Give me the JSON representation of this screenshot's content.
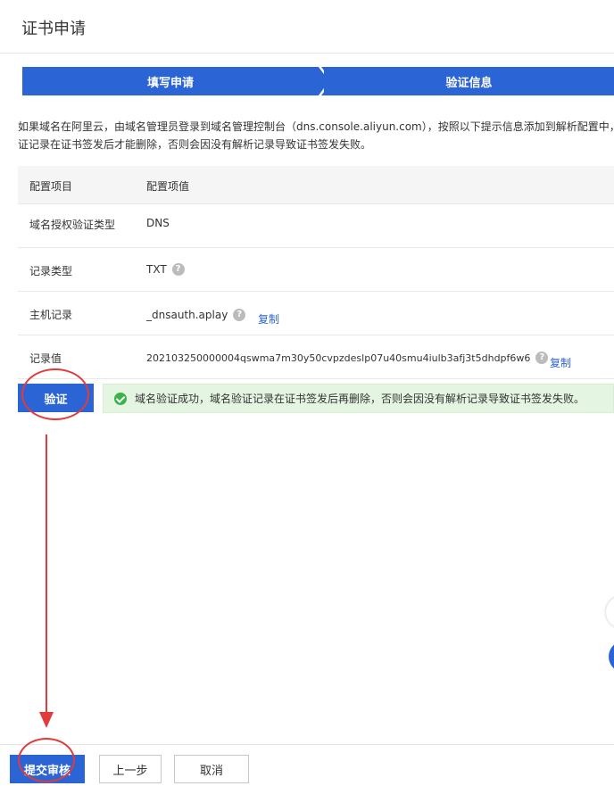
{
  "page": {
    "title": "证书申请"
  },
  "steps": [
    {
      "label": "填写申请"
    },
    {
      "label": "验证信息"
    }
  ],
  "notice": {
    "line1": "如果域名在阿里云，由域名管理员登录到域名管理控制台（dns.console.aliyun.com），按照以下提示信息添加到解析配置中，请",
    "line2": "证记录在证书签发后才能删除，否则会因没有解析记录导致证书签发失败。"
  },
  "table": {
    "header": {
      "key": "配置项目",
      "value": "配置项值"
    },
    "rows": [
      {
        "key": "域名授权验证类型",
        "value": "DNS"
      },
      {
        "key": "记录类型",
        "value": "TXT"
      },
      {
        "key": "主机记录",
        "value": "_dnsauth.aplay",
        "copy": "复制"
      },
      {
        "key": "记录值",
        "value": "202103250000004qswma7m30y50cvpzdeslp07u40smu4iulb3afj3t5dhdpf6w6",
        "copy": "复制"
      }
    ]
  },
  "verify": {
    "button": "验证",
    "success_message": "域名验证成功，域名验证记录在证书签发后再删除，否则会因没有解析记录导致证书签发失败。"
  },
  "footer": {
    "submit": "提交审核",
    "prev": "上一步",
    "cancel": "取消"
  },
  "colors": {
    "primary": "#2b64d5",
    "success": "#3bb34a",
    "annotation": "#e23b3b"
  },
  "icons": {
    "help": "question-circle-icon",
    "success": "check-circle-icon"
  }
}
